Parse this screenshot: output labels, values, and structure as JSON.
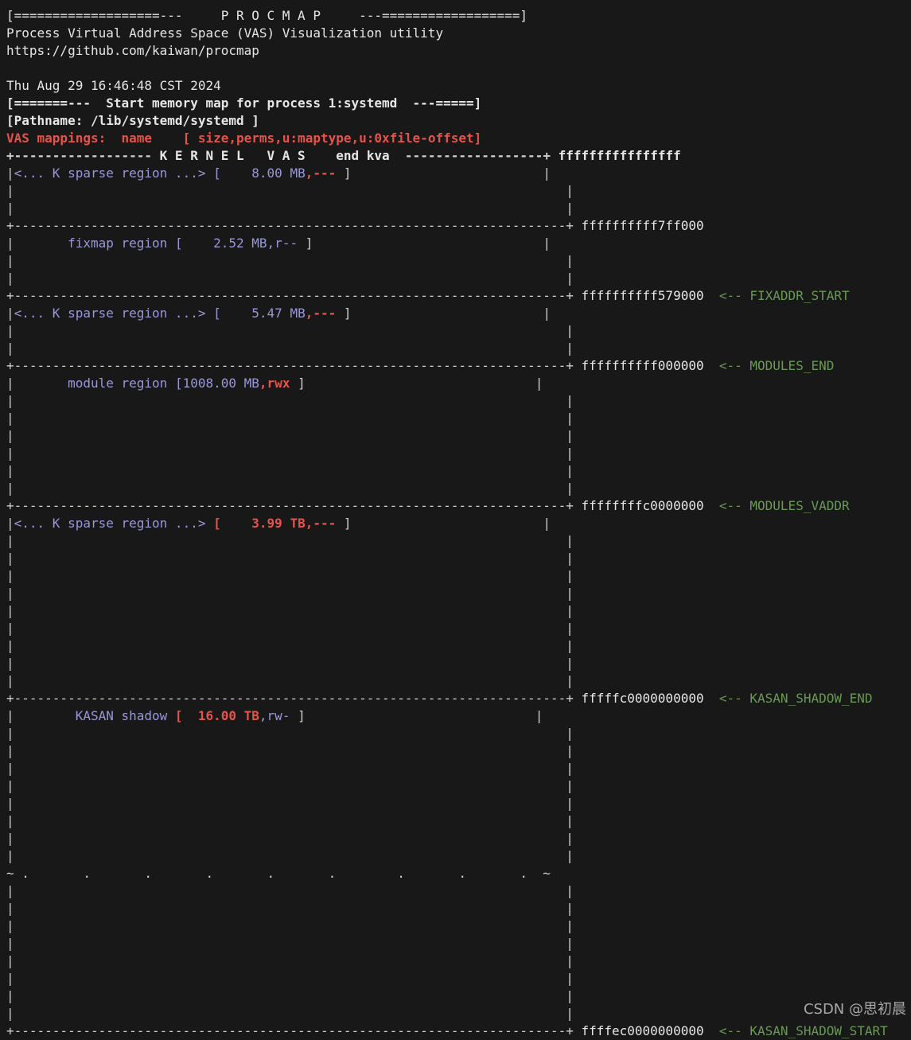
{
  "header": {
    "banner": "[===================---     P R O C M A P     ---==================]",
    "subtitle": "Process Virtual Address Space (VAS) Visualization utility",
    "url": "https://github.com/kaiwan/procmap",
    "date": "Thu Aug 29 16:46:48 CST 2024",
    "start_line": "[=======---  Start memory map for process 1:systemd  ---=====]",
    "pathname": "[Pathname: /lib/systemd/systemd ]",
    "vas_label": "VAS mappings:  name",
    "vas_fields": "[ size,perms,u:maptype,u:0xfile-offset]"
  },
  "kernel_header": {
    "left": "+------------------",
    "title": " K E R N E L   V A S    end kva  ",
    "right": "------------------+",
    "addr": "ffffffffffffffff"
  },
  "regions": [
    {
      "name": "<... K sparse region ...>",
      "size": "8.00",
      "unit": "MB",
      "perms": ",---",
      "end_addr": "ffffffffff7ff000",
      "marker": ""
    },
    {
      "name": "fixmap region",
      "size": "2.52",
      "unit": "MB",
      "perms": ",r--",
      "end_addr": "ffffffffff579000",
      "marker": "<-- FIXADDR_START"
    },
    {
      "name": "<... K sparse region ...>",
      "size": "5.47",
      "unit": "MB",
      "perms": ",---",
      "end_addr": "ffffffffff000000",
      "marker": "<-- MODULES_END"
    },
    {
      "name": "module region",
      "size": "1008.00",
      "unit": "MB",
      "perms": ",rwx",
      "end_addr": "ffffffffc0000000",
      "marker": "<-- MODULES_VADDR"
    },
    {
      "name": "<... K sparse region ...>",
      "size": "3.99",
      "unit": "TB",
      "perms": ",---",
      "end_addr": "fffffc0000000000",
      "marker": "<-- KASAN_SHADOW_END"
    },
    {
      "name": "KASAN shadow",
      "size": "16.00",
      "unit": "TB",
      "perms": ",rw-",
      "end_addr": "ffffec0000000000",
      "marker": "<-- KASAN_SHADOW_START"
    }
  ],
  "ellipsis_row": "~ .       .       .       .       .       .        .       .       .  ~",
  "watermark": "CSDN @思初晨",
  "colors": {
    "background": "#181818",
    "text": "#d4d4d4",
    "accent_red": "#e5534b",
    "region_name": "#9a97d8",
    "marker_green": "#6a9955"
  }
}
